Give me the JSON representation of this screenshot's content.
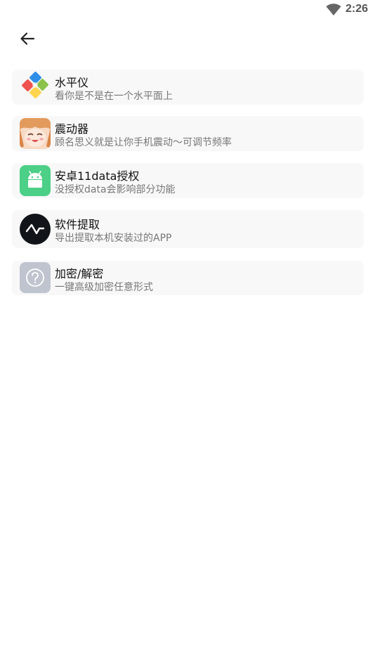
{
  "status_bar": {
    "time": "2:26",
    "wifi_icon": "wifi-icon"
  },
  "toolbar": {
    "back_icon": "arrow-left-icon"
  },
  "items": [
    {
      "title": "水平仪",
      "subtitle": "看你是不是在一个水平面上",
      "icon": "puzzle-icon"
    },
    {
      "title": "震动器",
      "subtitle": "顾名思义就是让你手机震动～可调节频率",
      "icon": "anime-avatar-icon"
    },
    {
      "title": "安卓11data授权",
      "subtitle": "没授权data会影响部分功能",
      "icon": "android-icon"
    },
    {
      "title": "软件提取",
      "subtitle": "导出提取本机安装过的APP",
      "icon": "pulse-icon"
    },
    {
      "title": "加密/解密",
      "subtitle": "一键高级加密任意形式",
      "icon": "question-icon"
    }
  ],
  "colors": {
    "background": "#ffffff",
    "card": "#f8f8f8",
    "title": "#111111",
    "subtitle": "#777777",
    "android_green": "#4ccf87",
    "pulse_bg": "#111418",
    "question_bg": "#bfc4cf"
  }
}
